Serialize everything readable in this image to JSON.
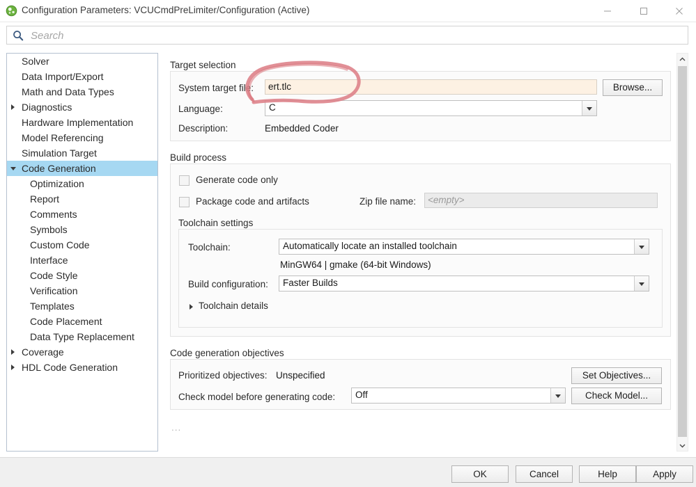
{
  "window": {
    "title": "Configuration Parameters: VCUCmdPreLimiter/Configuration (Active)",
    "app_icon": "simulink-icon",
    "controls": {
      "minimize": "minimize-icon",
      "maximize": "maximize-icon",
      "close": "close-icon"
    }
  },
  "search": {
    "placeholder": "Search",
    "value": "",
    "icon": "search-icon"
  },
  "sidebar": {
    "items": [
      {
        "label": "Solver",
        "indent": 1,
        "expander": "none",
        "selected": false
      },
      {
        "label": "Data Import/Export",
        "indent": 1,
        "expander": "none",
        "selected": false
      },
      {
        "label": "Math and Data Types",
        "indent": 1,
        "expander": "none",
        "selected": false
      },
      {
        "label": "Diagnostics",
        "indent": 1,
        "expander": "collapsed",
        "selected": false
      },
      {
        "label": "Hardware Implementation",
        "indent": 1,
        "expander": "none",
        "selected": false
      },
      {
        "label": "Model Referencing",
        "indent": 1,
        "expander": "none",
        "selected": false
      },
      {
        "label": "Simulation Target",
        "indent": 1,
        "expander": "none",
        "selected": false
      },
      {
        "label": "Code Generation",
        "indent": 1,
        "expander": "expanded",
        "selected": true
      },
      {
        "label": "Optimization",
        "indent": 2,
        "expander": "none",
        "selected": false
      },
      {
        "label": "Report",
        "indent": 2,
        "expander": "none",
        "selected": false
      },
      {
        "label": "Comments",
        "indent": 2,
        "expander": "none",
        "selected": false
      },
      {
        "label": "Symbols",
        "indent": 2,
        "expander": "none",
        "selected": false
      },
      {
        "label": "Custom Code",
        "indent": 2,
        "expander": "none",
        "selected": false
      },
      {
        "label": "Interface",
        "indent": 2,
        "expander": "none",
        "selected": false
      },
      {
        "label": "Code Style",
        "indent": 2,
        "expander": "none",
        "selected": false
      },
      {
        "label": "Verification",
        "indent": 2,
        "expander": "none",
        "selected": false
      },
      {
        "label": "Templates",
        "indent": 2,
        "expander": "none",
        "selected": false
      },
      {
        "label": "Code Placement",
        "indent": 2,
        "expander": "none",
        "selected": false
      },
      {
        "label": "Data Type Replacement",
        "indent": 2,
        "expander": "none",
        "selected": false
      },
      {
        "label": "Coverage",
        "indent": 1,
        "expander": "collapsed",
        "selected": false
      },
      {
        "label": "HDL Code Generation",
        "indent": 1,
        "expander": "collapsed",
        "selected": false
      }
    ],
    "selected_highlight_color": "#a6d8f2"
  },
  "target_selection": {
    "group_title": "Target selection",
    "system_target_file_label": "System target file:",
    "system_target_file_value": "ert.tlc",
    "browse_label": "Browse...",
    "language_label": "Language:",
    "language_value": "C",
    "description_label": "Description:",
    "description_value": "Embedded Coder"
  },
  "build_process": {
    "group_title": "Build process",
    "generate_code_only_label": "Generate code only",
    "generate_code_only_checked": false,
    "package_code_label": "Package code and artifacts",
    "package_code_checked": false,
    "zip_file_name_label": "Zip file name:",
    "zip_file_name_placeholder": "<empty>",
    "toolchain_settings_title": "Toolchain settings",
    "toolchain_label": "Toolchain:",
    "toolchain_value": "Automatically locate an installed toolchain",
    "toolchain_detected": "MinGW64 | gmake (64-bit Windows)",
    "build_configuration_label": "Build configuration:",
    "build_configuration_value": "Faster Builds",
    "toolchain_details_label": "Toolchain details",
    "toolchain_details_expanded": false
  },
  "code_generation_objectives": {
    "group_title": "Code generation objectives",
    "prioritized_objectives_label": "Prioritized objectives:",
    "prioritized_objectives_value": "Unspecified",
    "set_objectives_label": "Set Objectives...",
    "check_model_label": "Check model before generating code:",
    "check_model_value": "Off",
    "check_model_button_label": "Check Model..."
  },
  "overflow_indicator": "...",
  "scrollbar": {
    "up_icon": "chevron-up-icon",
    "down_icon": "chevron-down-icon"
  },
  "footer": {
    "ok_label": "OK",
    "cancel_label": "Cancel",
    "help_label": "Help",
    "apply_label": "Apply"
  },
  "annotation": {
    "type": "hand-drawn-ellipse",
    "color": "#dd7f87",
    "target": "system-target-file-field"
  }
}
